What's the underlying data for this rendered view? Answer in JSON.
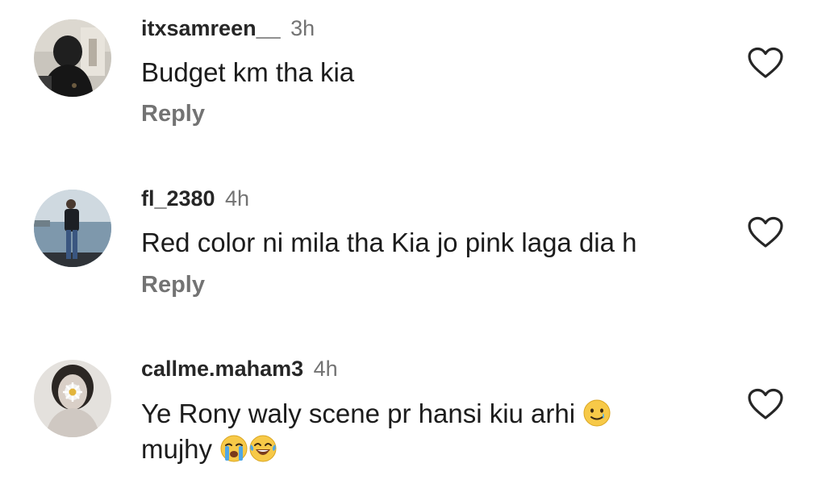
{
  "comments": [
    {
      "username": "itxsamreen__",
      "time": "3h",
      "text": "Budget km tha kia",
      "reply_label": "Reply",
      "avatar_icon": "profile-photo-dark-hoodie",
      "like_icon": "heart-outline-icon"
    },
    {
      "username": "fl_2380",
      "time": "4h",
      "text": "Red color ni mila tha Kia jo pink laga dia h",
      "reply_label": "Reply",
      "avatar_icon": "profile-photo-seaside",
      "like_icon": "heart-outline-icon"
    },
    {
      "username": "callme.maham3",
      "time": "4h",
      "text_line1": "Ye Rony waly scene pr hansi kiu arhi",
      "text_line2": "mujhy",
      "emojis": [
        "smiling-face-with-tear-emoji",
        "loudly-crying-face-emoji",
        "face-with-tears-of-joy-emoji"
      ],
      "avatar_icon": "profile-photo-flower",
      "like_icon": "heart-outline-icon"
    }
  ],
  "colors": {
    "username": "#262626",
    "timestamp": "#737373",
    "reply": "#737373",
    "text": "#1c1c1c",
    "heart_stroke": "#262626"
  }
}
